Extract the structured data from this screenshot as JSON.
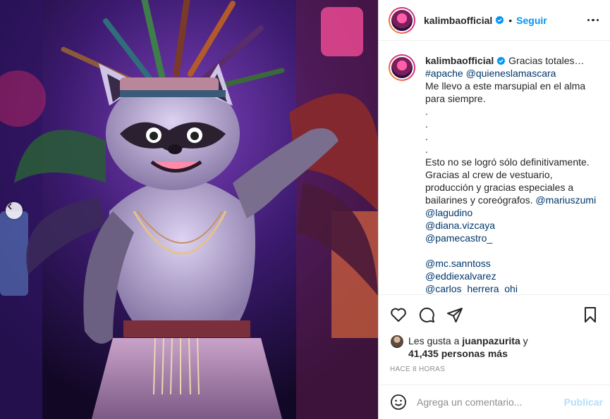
{
  "post": {
    "username": "kalimbaofficial",
    "follow_label": "Seguir",
    "separator": "•"
  },
  "caption": {
    "username": "kalimbaofficial",
    "lines": [
      {
        "text": "Gracias totales…",
        "kind": "first"
      },
      {
        "text": "#apache @quieneslamascara",
        "kind": "link"
      },
      {
        "text": "Me llevo a este marsupial en el alma",
        "kind": "text"
      },
      {
        "text": "para siempre.",
        "kind": "text"
      },
      {
        "text": ".",
        "kind": "text"
      },
      {
        "text": ".",
        "kind": "text"
      },
      {
        "text": ".",
        "kind": "text"
      },
      {
        "text": ".",
        "kind": "text"
      },
      {
        "text": "Esto no se logró sólo definitivamente.",
        "kind": "text"
      },
      {
        "text": "Gracias al crew de vestuario,",
        "kind": "text"
      },
      {
        "text": "producción y gracias especiales a",
        "kind": "text"
      },
      {
        "text": "bailarines y coreógrafos.",
        "kind": "text",
        "trailing_link": "@mariuszumi"
      },
      {
        "text": "@lagudino",
        "kind": "link"
      },
      {
        "text": "@diana.vizcaya",
        "kind": "link"
      },
      {
        "text": "@pamecastro_",
        "kind": "link"
      },
      {
        "text": "",
        "kind": "blank"
      },
      {
        "text": "@mc.sanntoss",
        "kind": "link"
      },
      {
        "text": "@eddiexalvarez",
        "kind": "link"
      },
      {
        "text": "@carlos_herrera_ohi",
        "kind": "link"
      }
    ]
  },
  "likes": {
    "prefix": "Les gusta a",
    "user": "juanpazurita",
    "joiner": "y",
    "others": "41,435 personas más"
  },
  "timestamp": "HACE 8 HORAS",
  "comment": {
    "placeholder": "Agrega un comentario...",
    "publish_label": "Publicar"
  },
  "icons": {
    "verified": "verified-badge-icon",
    "more": "more-options-icon",
    "like": "heart-icon",
    "comment": "comment-bubble-icon",
    "share": "paper-plane-icon",
    "save": "bookmark-icon",
    "emoji": "emoji-smile-icon",
    "prev": "chevron-left-icon"
  },
  "colors": {
    "accent": "#0095f6",
    "link": "#00376b",
    "muted": "#8e8e8e",
    "publish_disabled": "#b2dffc"
  }
}
